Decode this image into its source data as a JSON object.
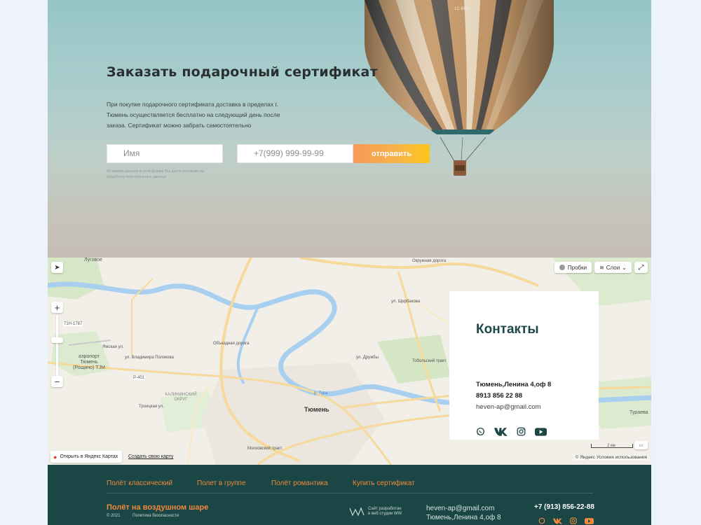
{
  "hero": {
    "title": "Заказать подарочный сертификат",
    "description": "При покупке подарочного сертификата доставка в пределах г. Тюмень осуществляется бесплатно на следующий день после заказа. Сертификат можно забрать самостоятельно",
    "name_placeholder": "Имя",
    "phone_placeholder": "+7(999) 999-99-99",
    "submit_label": "отправить",
    "consent": "Оставляя данные в этой форме Вы даете согласие на обработку персональных данных",
    "balloon_registration": "1С-ВКН"
  },
  "map": {
    "traffic_label": "Пробки",
    "layers_label": "Слои",
    "open_label": "Открыть в Яндекс Картах",
    "create_label": "Создать свою карту",
    "copyright": "© Яндекс Условия использования",
    "scale": "2 км",
    "labels": {
      "lugovoe": "Луговое",
      "airport": "аэропорт Тюмень (Рощино) TJM",
      "tyumen": "Тюмень",
      "kalininsky": "КАЛИНИНСКИЙ ОКРУГ",
      "turaeva": "Тураева",
      "road_r401": "Р-401",
      "road_71n": "71Н-1787",
      "tura": "р. Тура",
      "obezdnaya": "Объездная дорога",
      "okruzhnaya": "Окружная дорога",
      "shcherbakova": "ул. Щербакова",
      "druzhby": "ул. Дружбы",
      "tobolsky": "Тобольский тракт",
      "moskovsky": "Московский тракт",
      "yamskaya": "Ямская ул.",
      "vladimira": "ул. Владимира Полякова",
      "trotsky": "Троицкая ул."
    }
  },
  "contacts": {
    "title": "Контакты",
    "address": "Тюмень,Ленина 4,оф 8",
    "phone": "8913 856 22 88",
    "email": "heven-ap@gmail.com",
    "socials": [
      "whatsapp-icon",
      "vk-icon",
      "instagram-icon",
      "youtube-icon"
    ]
  },
  "footer": {
    "nav": [
      "Полёт классический",
      "Полет в группе",
      "Полёт романтика",
      "Купить сертификат"
    ],
    "brand": "Полёт на воздушном шаре",
    "year": "© 2021",
    "policy": "Политика безопасности",
    "developer": "Сайт разработан в веб студии WW",
    "email": "heven-ap@gmail.com",
    "address": "Тюмень,Ленина 4,оф 8",
    "phone": "+7 (913) 856-22-88"
  },
  "colors": {
    "accent": "#f0883e",
    "footer_bg": "#1a4745",
    "heading": "#1b4846"
  }
}
